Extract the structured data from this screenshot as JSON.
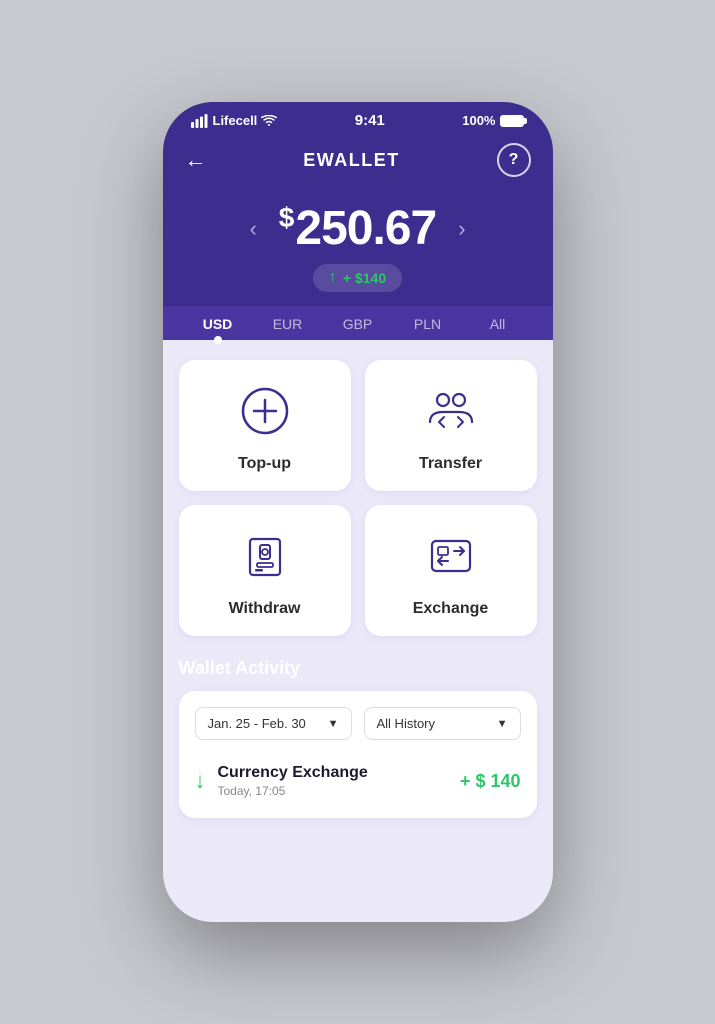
{
  "statusBar": {
    "carrier": "Lifecell",
    "time": "9:41",
    "battery": "100%"
  },
  "header": {
    "title": "EWALLET",
    "helpLabel": "?"
  },
  "balance": {
    "currencySymbol": "$",
    "amount": "250.67",
    "badge": "+ $140",
    "navLeft": "‹",
    "navRight": "›"
  },
  "currencyTabs": [
    {
      "label": "USD",
      "active": true
    },
    {
      "label": "EUR",
      "active": false
    },
    {
      "label": "GBP",
      "active": false
    },
    {
      "label": "PLN",
      "active": false
    },
    {
      "label": "All",
      "active": false
    }
  ],
  "actions": [
    {
      "id": "topup",
      "label": "Top-up",
      "icon": "topup-icon"
    },
    {
      "id": "transfer",
      "label": "Transfer",
      "icon": "transfer-icon"
    },
    {
      "id": "withdraw",
      "label": "Withdraw",
      "icon": "withdraw-icon"
    },
    {
      "id": "exchange",
      "label": "Exchange",
      "icon": "exchange-icon"
    }
  ],
  "walletActivity": {
    "title": "Wallet Activity",
    "dateFilter": "Jan. 25 - Feb. 30",
    "historyFilter": "All History",
    "transactions": [
      {
        "type": "credit",
        "title": "Currency Exchange",
        "time": "Today, 17:05",
        "amount": "+ $ 140"
      }
    ]
  }
}
